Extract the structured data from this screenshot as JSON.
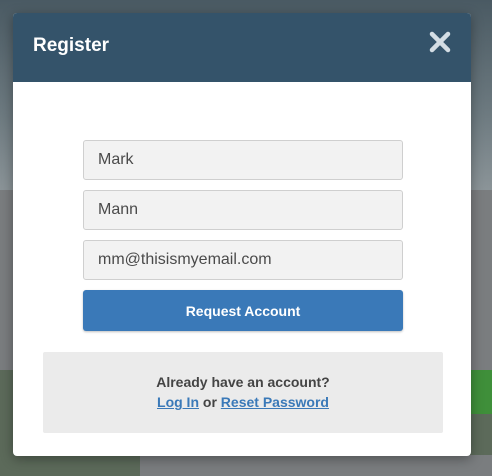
{
  "dialog": {
    "title": "Register",
    "close_icon": "close-icon"
  },
  "form": {
    "first_name_value": "Mark",
    "last_name_value": "Mann",
    "email_value": "mm@thisismyemail.com",
    "submit_label": "Request Account"
  },
  "account": {
    "question": "Already have an account?",
    "login_label": "Log In",
    "or_text": "or",
    "reset_label": "Reset Password"
  },
  "colors": {
    "header": "#34536a",
    "button": "#3a79b8",
    "link": "#3a79b8",
    "panel": "#ebebeb"
  }
}
